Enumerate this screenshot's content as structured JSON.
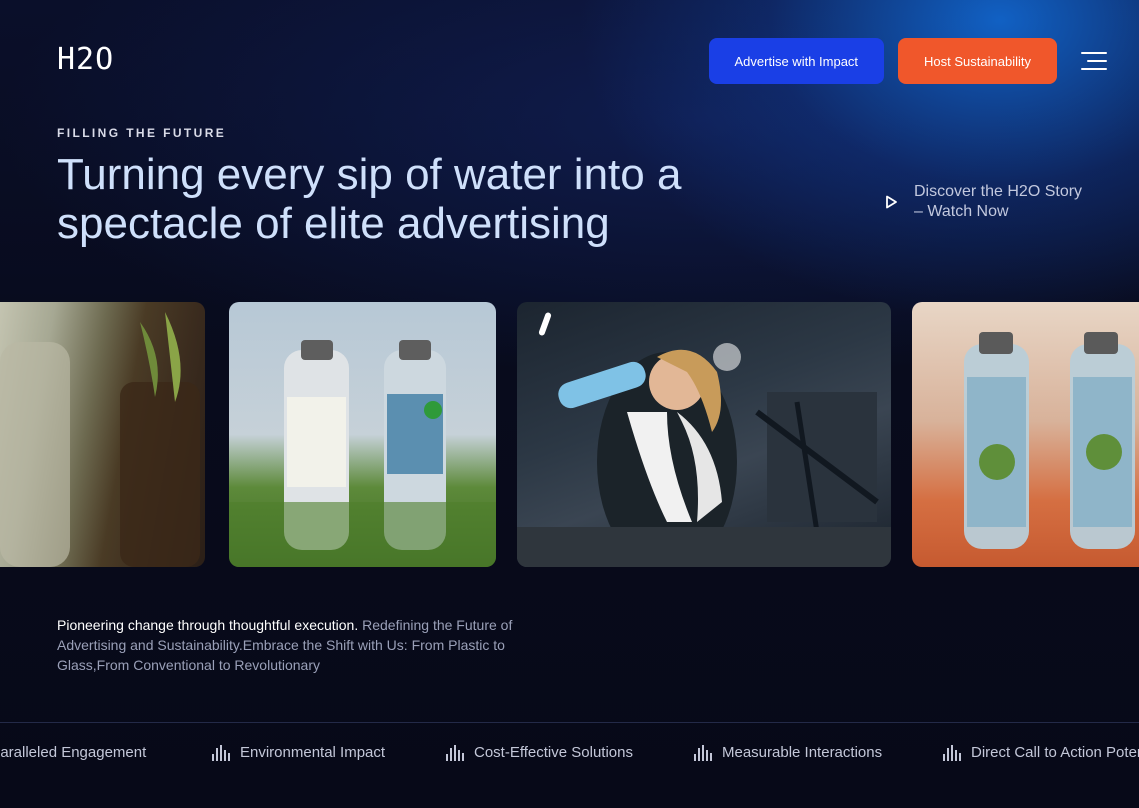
{
  "brand": {
    "logo_text": "H2O"
  },
  "nav": {
    "advertise_label": "Advertise with Impact",
    "host_label": "Host Sustainability",
    "menu_icon": "hamburger-menu-icon"
  },
  "hero": {
    "eyebrow": "FILLING THE FUTURE",
    "headline": "Turning every sip of water into a spectacle of elite advertising",
    "watch_label": "Discover the H2O Story – Watch Now",
    "watch_icon": "play-icon"
  },
  "gallery": {
    "cards": [
      {
        "name": "water-bottle-closeup"
      },
      {
        "name": "bottles-on-grass"
      },
      {
        "name": "woman-drinking-gym"
      },
      {
        "name": "bottles-orange-background"
      }
    ]
  },
  "description": {
    "lead": "Pioneering change through  thoughtful execution.",
    "body": " Redefining the Future of Advertising and Sustainability.Embrace the Shift with Us: From Plastic to Glass,From Conventional to Revolutionary"
  },
  "ticker": {
    "items": [
      "paralleled Engagement",
      "Environmental Impact",
      "Cost-Effective Solutions",
      "Measurable Interactions",
      "Direct Call to Action Poter"
    ],
    "icon": "bar-chart-icon"
  },
  "colors": {
    "background": "#080b1c",
    "button_blue": "#1a3fe6",
    "button_orange": "#f0572b",
    "headline": "#cfe0fb"
  }
}
